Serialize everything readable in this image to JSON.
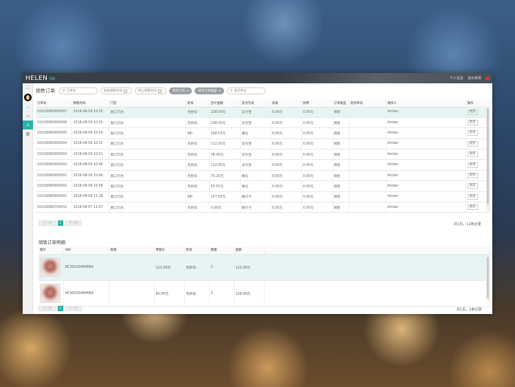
{
  "app": {
    "logo": "HELEN",
    "logo_sub": "OA",
    "profile": "个人信息",
    "logout": "退出系统"
  },
  "sidebar": {
    "items": [
      {
        "icon": "expand-icon",
        "glyph": "⛶"
      },
      {
        "icon": "chevron-down-icon",
        "glyph": "⌄"
      },
      {
        "icon": "card-icon",
        "glyph": "▭"
      },
      {
        "icon": "home-icon",
        "glyph": "⌂"
      },
      {
        "icon": "chart-icon",
        "glyph": "▥"
      }
    ]
  },
  "orders": {
    "title": "销售订单",
    "filters": {
      "order_no_placeholder": "订单号",
      "start_time": "起始销售时间",
      "end_time": "终止销售时间",
      "store": "所有门店",
      "order_type": "所有订单类型",
      "return_no_placeholder": "退货单号"
    },
    "columns": [
      "订单号",
      "销售时间",
      "门店",
      "折扣",
      "合计金额",
      "支付方式",
      "实收",
      "找零",
      "订单类型",
      "退货单号",
      "操作人",
      "操作"
    ],
    "rows": [
      [
        "O2018080900007",
        "2018-08-09 10:55",
        "壹口万达",
        "无折扣",
        "238.00元",
        "支付宝",
        "0.00元",
        "0.00元",
        "销售",
        "",
        "Amber",
        "退货"
      ],
      [
        "O2018080900006",
        "2018-08-09 10:55",
        "壹口万达",
        "无折扣",
        "238.00元",
        "支付宝",
        "0.00元",
        "0.00元",
        "销售",
        "",
        "Amber",
        "退货"
      ],
      [
        "O2018080900005",
        "2018-08-09 10:54",
        "壹口万达",
        "9折",
        "208.53元",
        "微信",
        "0.00元",
        "0.00元",
        "销售",
        "",
        "Amber",
        "退货"
      ],
      [
        "O2018080900004",
        "2018-08-09 10:52",
        "壹口万达",
        "无折扣",
        "112.00元",
        "支付宝",
        "0.00元",
        "0.00元",
        "销售",
        "",
        "Amber",
        "退货"
      ],
      [
        "O2018080900003",
        "2018-08-09 10:51",
        "壹口万达",
        "无折扣",
        "78.00元",
        "支付宝",
        "0.00元",
        "0.00元",
        "销售",
        "",
        "Amber",
        "退货"
      ],
      [
        "O2018080900002",
        "2018-08-09 10:48",
        "壹口万达",
        "无折扣",
        "112.00元",
        "支付宝",
        "0.00元",
        "0.00元",
        "销售",
        "",
        "Amber",
        "退货"
      ],
      [
        "O2018080900001",
        "2018-08-09 10:46",
        "壹口万达",
        "无折扣",
        "70.20元",
        "微信",
        "0.00元",
        "0.00元",
        "销售",
        "",
        "Amber",
        "退货"
      ],
      [
        "O2018080800002",
        "2018-08-08 16:58",
        "壹口万达",
        "无折扣",
        "53.55元",
        "微信",
        "0.00元",
        "0.00元",
        "销售",
        "",
        "Amber",
        "退货"
      ],
      [
        "O2018080800001",
        "2018-08-08 11:38",
        "壹口万达",
        "9折",
        "157.50元",
        "银行卡",
        "0.00元",
        "0.00元",
        "销售",
        "",
        "Amber",
        "退货"
      ],
      [
        "O2018080700002",
        "2018-08-07 11:07",
        "壹口万达",
        "无折扣",
        "0.00元",
        "银行卡",
        "0.00元",
        "0.00元",
        "销售",
        "",
        "Amber",
        "退货"
      ]
    ],
    "pager": {
      "prev": "上一页",
      "page": "1",
      "next": "下一页",
      "summary": "共1页，11条记录"
    }
  },
  "details": {
    "title": "销售订单明细",
    "columns": [
      "图片",
      "SKU",
      "规格",
      "零售价",
      "折扣",
      "数量",
      "金额"
    ],
    "rows": [
      [
        "",
        "HC3001545PKNA",
        "",
        "112.00元",
        "无折扣",
        "1",
        "112.00元"
      ],
      [
        "",
        "HC3001546PKNA",
        "",
        "63.00元",
        "无折扣",
        "2",
        "126.00元"
      ]
    ],
    "pager": {
      "prev": "上一页",
      "page": "1",
      "next": "下一页",
      "summary": "共1页，2条记录"
    }
  },
  "colors": {
    "accent": "#2ab3a8",
    "titlebar": "#3a3f46",
    "selected_row": "#e6f5f3"
  }
}
